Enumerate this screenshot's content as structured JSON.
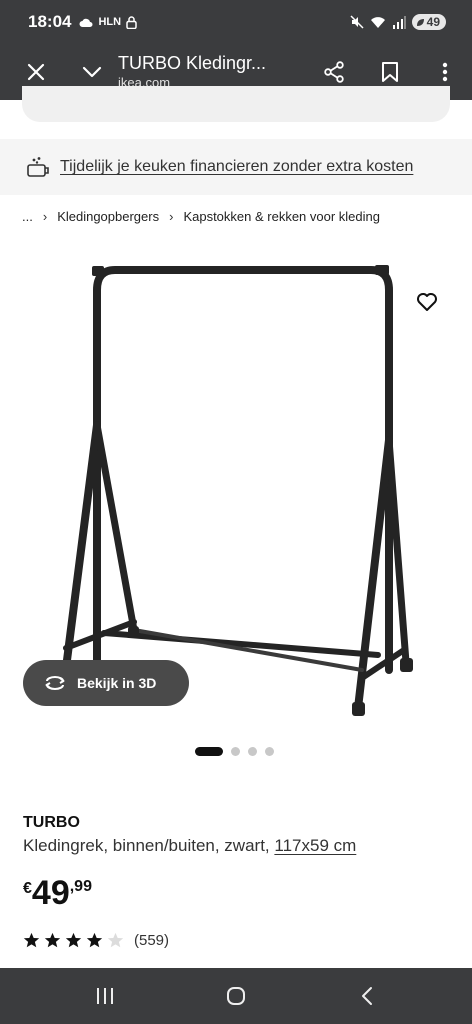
{
  "status_bar": {
    "time": "18:04",
    "carrier_label": "HLN",
    "battery": "49"
  },
  "browser": {
    "page_title": "TURBO Kledingr...",
    "domain": "ikea.com"
  },
  "finance_banner": {
    "text": "Tijdelijk je keuken financieren zonder extra kosten"
  },
  "breadcrumb": {
    "ellipsis": "...",
    "items": [
      "Kledingopbergers",
      "Kapstokken & rekken voor kleding"
    ]
  },
  "gallery": {
    "view_3d_label": "Bekijk in 3D",
    "total_images": 4,
    "active_index": 0
  },
  "product": {
    "name": "TURBO",
    "description": "Kledingrek, binnen/buiten, zwart,",
    "size": "117x59 cm",
    "price": {
      "currency": "€",
      "integer": "49",
      "decimal": ",99"
    },
    "rating": {
      "stars": 4,
      "max": 5,
      "count": "(559)"
    }
  },
  "icons": {
    "close": "close-icon",
    "expand": "chevron-down-icon",
    "share": "share-icon",
    "bookmark": "bookmark-icon",
    "menu": "more-vert-icon",
    "favorite": "heart-icon",
    "rotate": "rotate-3d-icon",
    "finance": "finance-icon",
    "nav_recent": "recent-apps-icon",
    "nav_home": "home-icon",
    "nav_back": "back-icon"
  },
  "colors": {
    "system_bar": "#3b3c3e",
    "banner_bg": "#f5f5f5",
    "button_3d": "#4a4a4a",
    "text": "#111111"
  }
}
